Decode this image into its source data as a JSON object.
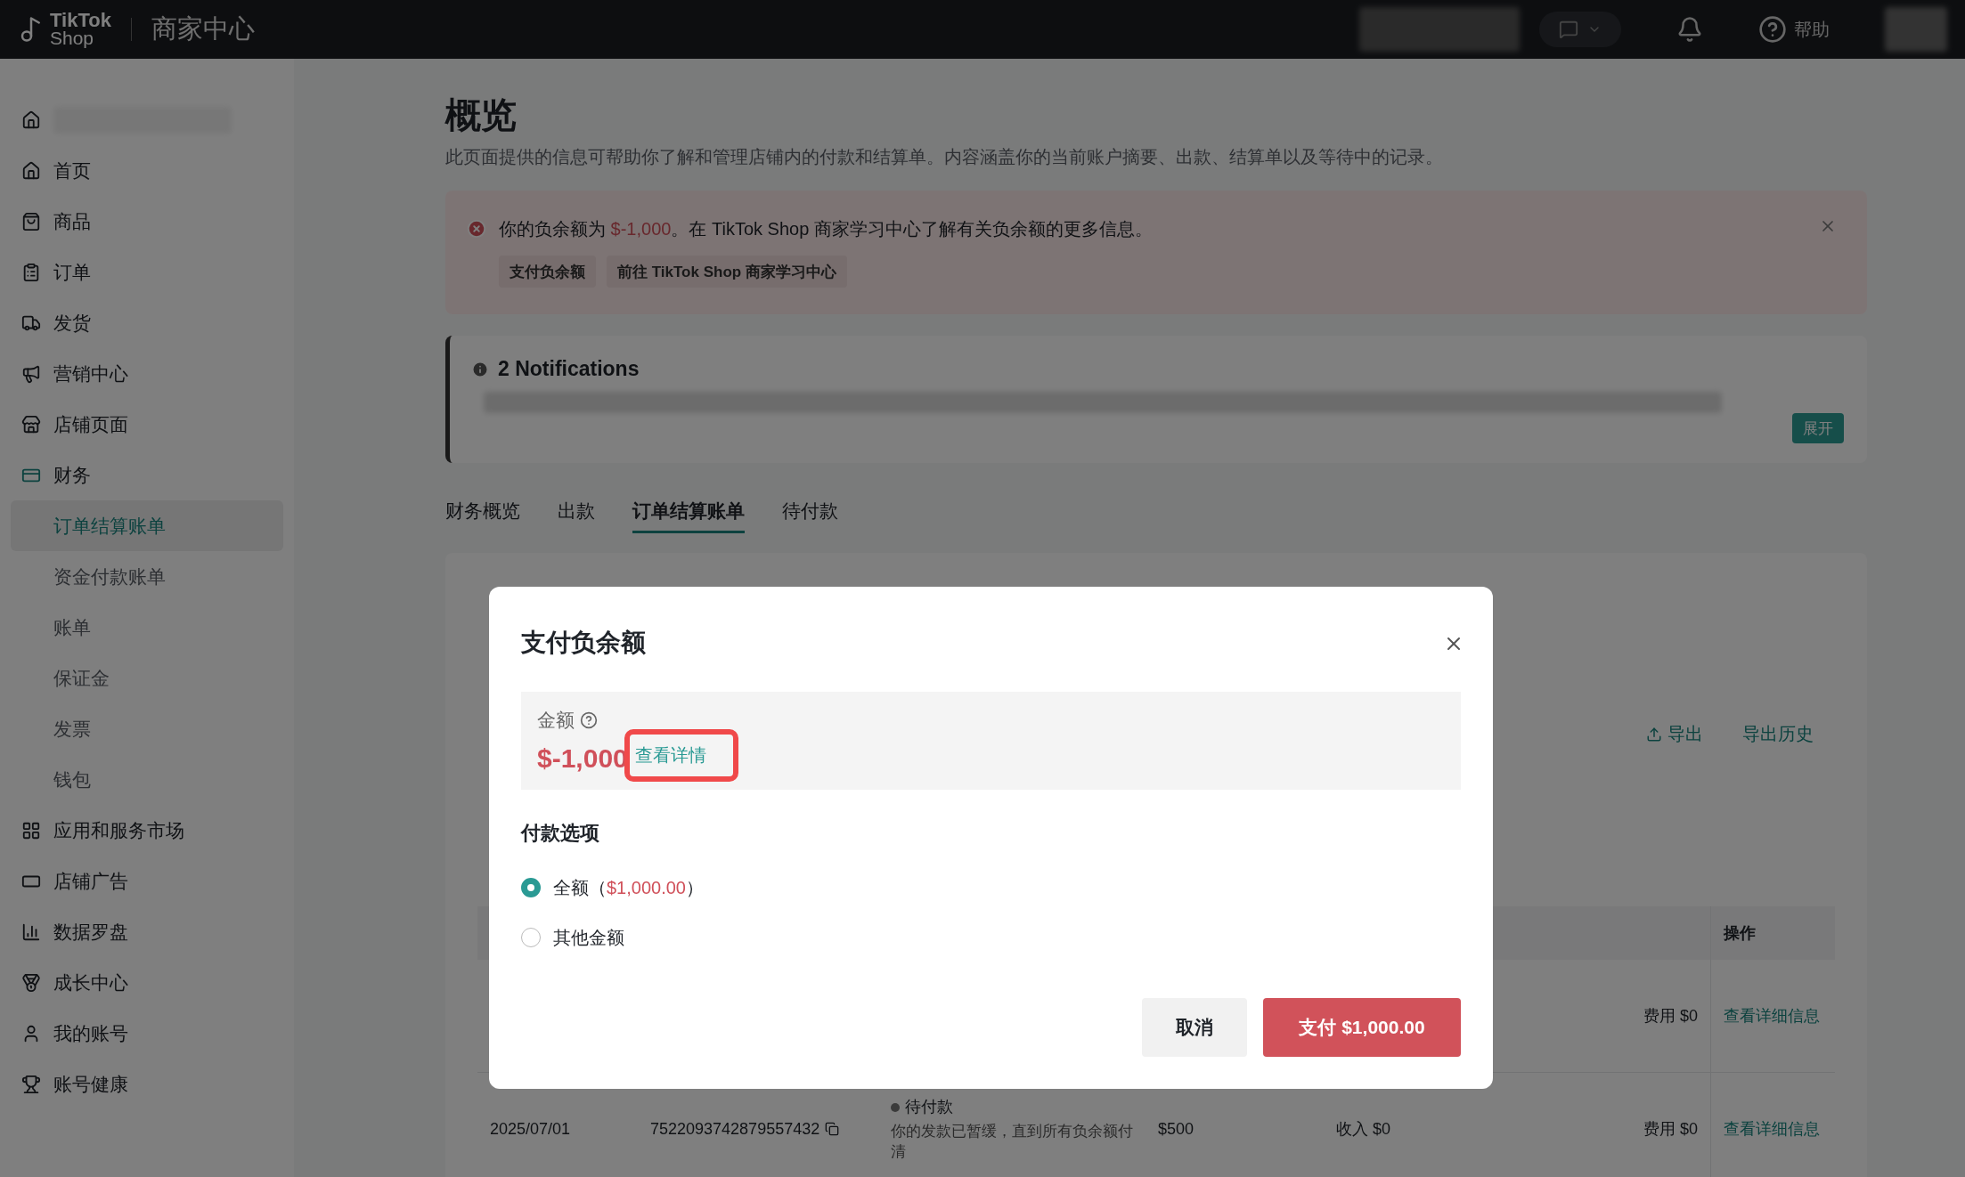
{
  "topbar": {
    "logo_top": "TikTok",
    "logo_bottom": "Shop",
    "product": "商家中心",
    "help": "帮助"
  },
  "sidebar": {
    "items": [
      {
        "label": "首页"
      },
      {
        "label": "商品"
      },
      {
        "label": "订单"
      },
      {
        "label": "发货"
      },
      {
        "label": "营销中心"
      },
      {
        "label": "店铺页面"
      },
      {
        "label": "财务",
        "expanded": true,
        "children": [
          {
            "label": "订单结算账单",
            "selected": true
          },
          {
            "label": "资金付款账单",
            "selected": false
          },
          {
            "label": "账单",
            "selected": false
          },
          {
            "label": "保证金",
            "selected": false
          },
          {
            "label": "发票",
            "selected": false
          },
          {
            "label": "钱包",
            "selected": false
          }
        ]
      },
      {
        "label": "应用和服务市场"
      },
      {
        "label": "店铺广告"
      },
      {
        "label": "数据罗盘"
      },
      {
        "label": "成长中心"
      },
      {
        "label": "我的账号"
      },
      {
        "label": "账号健康"
      }
    ]
  },
  "page": {
    "title": "概览",
    "description": "此页面提供的信息可帮助你了解和管理店铺内的付款和结算单。内容涵盖你的当前账户摘要、出款、结算单以及等待中的记录。"
  },
  "alert": {
    "prefix": "你的负余额为 ",
    "amount": "$-1,000",
    "suffix": "。在 TikTok Shop 商家学习中心了解有关负余额的更多信息。",
    "buttons": [
      "支付负余额",
      "前往 TikTok Shop 商家学习中心"
    ]
  },
  "notifications": {
    "title": "2 Notifications",
    "button": "展开"
  },
  "tabs": [
    {
      "label": "财务概览",
      "selected": false
    },
    {
      "label": "出款",
      "selected": false
    },
    {
      "label": "订单结算账单",
      "selected": true
    },
    {
      "label": "待付款",
      "selected": false
    }
  ],
  "statements": {
    "actions": [
      "导出",
      "导出历史"
    ],
    "table": {
      "columns": [
        "操作"
      ],
      "rows": [
        {
          "date": "",
          "id": "",
          "status": "",
          "note": "",
          "amount": "",
          "income": "",
          "fee": "费用 $0",
          "action": "查看详细信息"
        },
        {
          "date": "2025/07/01",
          "id": "7522093742879557432",
          "status": "待付款",
          "note": "你的发款已暂缓，直到所有负余额付清",
          "amount": "$500",
          "income": "收入 $0",
          "fee": "费用 $0",
          "action": "查看详细信息"
        }
      ]
    }
  },
  "modal": {
    "title": "支付负余额",
    "amount_label": "金额",
    "amount": "$-1,000",
    "details_link": "查看详情",
    "highlighted": true,
    "options_title": "付款选项",
    "options": [
      {
        "label": "全额（",
        "amount": "$1,000.00",
        "suffix": "）",
        "selected": true
      },
      {
        "label": "其他金额",
        "selected": false
      }
    ],
    "cancel": "取消",
    "pay": "支付 $1,000.00"
  }
}
